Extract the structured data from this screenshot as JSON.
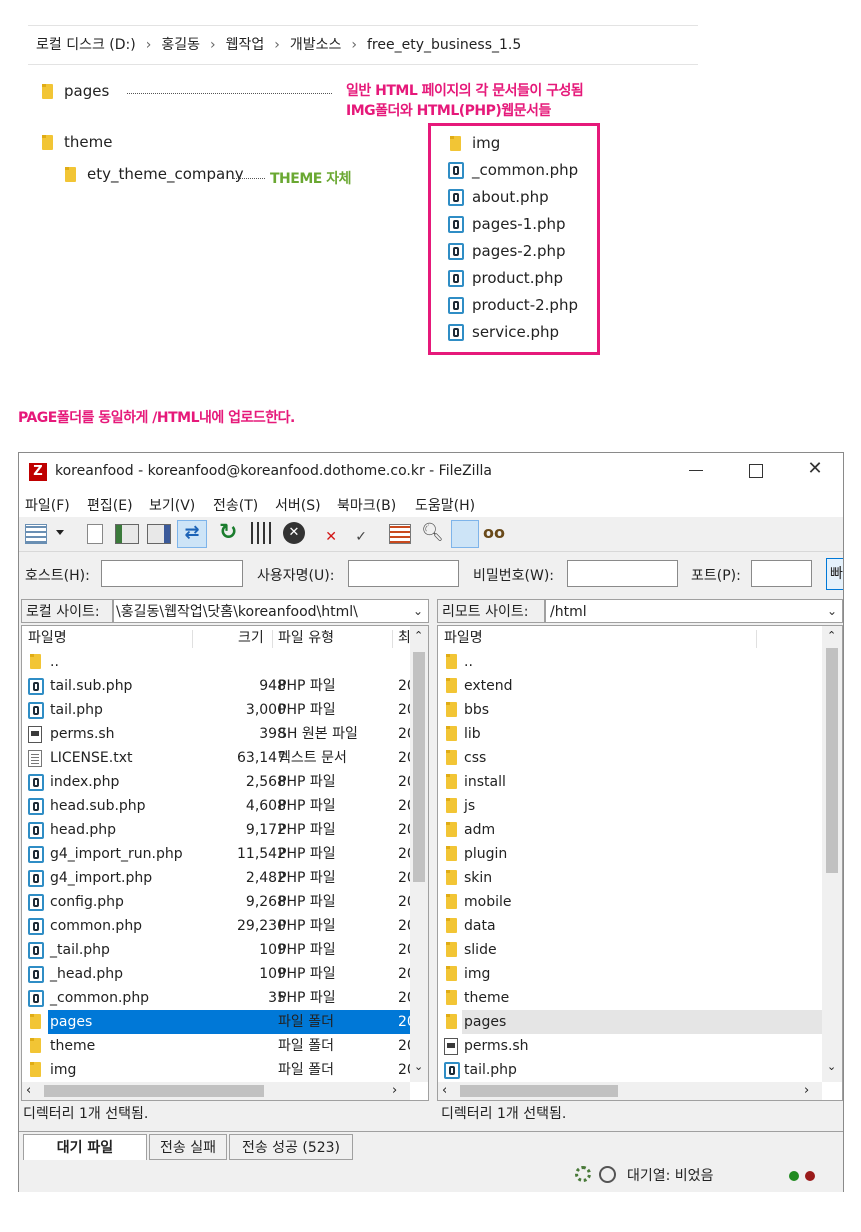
{
  "breadcrumb": [
    "로컬 디스크 (D:)",
    "홍길동",
    "웹작업",
    "개발소스",
    "free_ety_business_1.5"
  ],
  "tree": {
    "pages": "pages",
    "theme": "theme",
    "ety": "ety_theme_company"
  },
  "annotations": {
    "pages_line1": "일반 HTML 페이지의 각 문서들이 구성됨",
    "pages_line2": "IMG폴더와 HTML(PHP)웹문서들",
    "theme_note": "THEME 자체",
    "upload_note": "PAGE폴더를 동일하게  /HTML내에 업로드한다."
  },
  "colors": {
    "magenta": "#e6197a",
    "green": "#6aa832",
    "selection": "#0078d7"
  },
  "pages_files": [
    {
      "name": "img",
      "type": "folder"
    },
    {
      "name": "_common.php",
      "type": "php"
    },
    {
      "name": "about.php",
      "type": "php"
    },
    {
      "name": "pages-1.php",
      "type": "php"
    },
    {
      "name": "pages-2.php",
      "type": "php"
    },
    {
      "name": "product.php",
      "type": "php"
    },
    {
      "name": "product-2.php",
      "type": "php"
    },
    {
      "name": "service.php",
      "type": "php"
    }
  ],
  "window": {
    "title": "koreanfood - koreanfood@koreanfood.dothome.co.kr - FileZilla",
    "menu": [
      "파일(F)",
      "편집(E)",
      "보기(V)",
      "전송(T)",
      "서버(S)",
      "북마크(B)",
      "도움말(H)"
    ],
    "toolbar_icons": [
      "site-manager-icon",
      "dropdown-icon",
      "message-log-icon",
      "local-tree-icon",
      "remote-tree-icon",
      "transfer-queue-icon",
      "refresh-icon",
      "filter-icon",
      "cancel-icon",
      "disconnect-icon",
      "reconnect-icon",
      "compare-icon",
      "search-remote-icon",
      "sync-browse-icon",
      "find-files-icon"
    ],
    "quickconnect": {
      "host_label": "호스트(H):",
      "user_label": "사용자명(U):",
      "pass_label": "비밀번호(W):",
      "port_label": "포트(P):",
      "host_value": "",
      "user_value": "",
      "pass_value": "",
      "port_value": "",
      "button": "빠"
    },
    "local": {
      "site_label": "로컬 사이트:",
      "path": "\\홍길동\\웹작업\\닷홈\\koreanfood\\html\\",
      "headers": {
        "name": "파일명",
        "size": "크기",
        "type": "파일 유형",
        "date": "최"
      },
      "rows": [
        {
          "name": "..",
          "size": "",
          "type": "",
          "date": "",
          "icon": "folder"
        },
        {
          "name": "tail.sub.php",
          "size": "948",
          "type": "PHP 파일",
          "date": "20",
          "icon": "php"
        },
        {
          "name": "tail.php",
          "size": "3,000",
          "type": "PHP 파일",
          "date": "20",
          "icon": "php"
        },
        {
          "name": "perms.sh",
          "size": "398",
          "type": "SH 원본 파일",
          "date": "20",
          "icon": "sh"
        },
        {
          "name": "LICENSE.txt",
          "size": "63,147",
          "type": "텍스트 문서",
          "date": "20",
          "icon": "txt"
        },
        {
          "name": "index.php",
          "size": "2,568",
          "type": "PHP 파일",
          "date": "20",
          "icon": "php"
        },
        {
          "name": "head.sub.php",
          "size": "4,608",
          "type": "PHP 파일",
          "date": "20",
          "icon": "php"
        },
        {
          "name": "head.php",
          "size": "9,172",
          "type": "PHP 파일",
          "date": "20",
          "icon": "php"
        },
        {
          "name": "g4_import_run.php",
          "size": "11,542",
          "type": "PHP 파일",
          "date": "20",
          "icon": "php"
        },
        {
          "name": "g4_import.php",
          "size": "2,482",
          "type": "PHP 파일",
          "date": "20",
          "icon": "php"
        },
        {
          "name": "config.php",
          "size": "9,268",
          "type": "PHP 파일",
          "date": "20",
          "icon": "php"
        },
        {
          "name": "common.php",
          "size": "29,230",
          "type": "PHP 파일",
          "date": "20",
          "icon": "php"
        },
        {
          "name": "_tail.php",
          "size": "109",
          "type": "PHP 파일",
          "date": "20",
          "icon": "php"
        },
        {
          "name": "_head.php",
          "size": "109",
          "type": "PHP 파일",
          "date": "20",
          "icon": "php"
        },
        {
          "name": "_common.php",
          "size": "35",
          "type": "PHP 파일",
          "date": "20",
          "icon": "php"
        },
        {
          "name": "pages",
          "size": "",
          "type": "파일 폴더",
          "date": "20",
          "icon": "folder",
          "selected": true
        },
        {
          "name": "theme",
          "size": "",
          "type": "파일 폴더",
          "date": "20",
          "icon": "folder"
        },
        {
          "name": "img",
          "size": "",
          "type": "파일 폴더",
          "date": "20",
          "icon": "folder"
        }
      ],
      "status": "디렉터리 1개 선택됨."
    },
    "remote": {
      "site_label": "리모트 사이트:",
      "path": "/html",
      "headers": {
        "name": "파일명"
      },
      "rows": [
        {
          "name": "..",
          "icon": "folder"
        },
        {
          "name": "extend",
          "icon": "folder"
        },
        {
          "name": "bbs",
          "icon": "folder"
        },
        {
          "name": "lib",
          "icon": "folder"
        },
        {
          "name": "css",
          "icon": "folder"
        },
        {
          "name": "install",
          "icon": "folder"
        },
        {
          "name": "js",
          "icon": "folder"
        },
        {
          "name": "adm",
          "icon": "folder"
        },
        {
          "name": "plugin",
          "icon": "folder"
        },
        {
          "name": "skin",
          "icon": "folder"
        },
        {
          "name": "mobile",
          "icon": "folder"
        },
        {
          "name": "data",
          "icon": "folder"
        },
        {
          "name": "slide",
          "icon": "folder"
        },
        {
          "name": "img",
          "icon": "folder"
        },
        {
          "name": "theme",
          "icon": "folder"
        },
        {
          "name": "pages",
          "icon": "folder",
          "highlight": true
        },
        {
          "name": "perms.sh",
          "icon": "sh"
        },
        {
          "name": "tail.php",
          "icon": "php"
        }
      ],
      "status": "디렉터리 1개 선택됨."
    },
    "queue_tabs": [
      "대기 파일",
      "전송 실패",
      "전송 성공 (523)"
    ],
    "queue_status": "대기열: 비었음"
  }
}
